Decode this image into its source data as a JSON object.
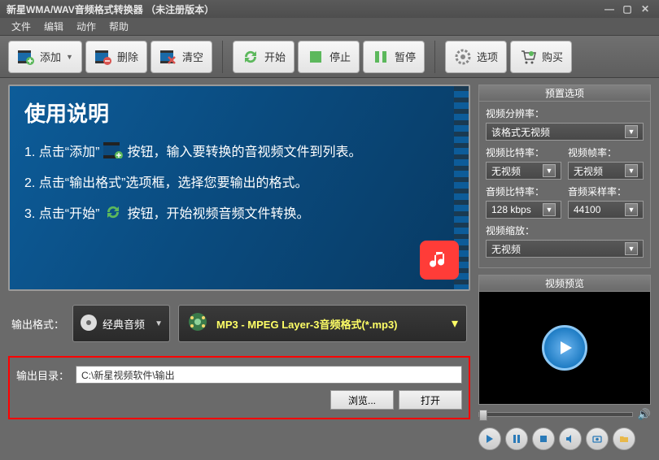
{
  "titlebar": {
    "title": "新星WMA/WAV音频格式转换器 （未注册版本）"
  },
  "menu": {
    "file": "文件",
    "edit": "编辑",
    "action": "动作",
    "help": "帮助"
  },
  "toolbar": {
    "add": "添加",
    "delete": "删除",
    "clear": "清空",
    "start": "开始",
    "stop": "停止",
    "pause": "暂停",
    "options": "选项",
    "buy": "购买"
  },
  "instruction": {
    "heading": "使用说明",
    "line1a": "1. 点击“添加”",
    "line1b": "按钮，输入要转换的音视频文件到列表。",
    "line2": "2. 点击“输出格式”选项框，选择您要输出的格式。",
    "line3a": "3. 点击“开始”",
    "line3b": "按钮，开始视频音频文件转换。"
  },
  "output_format": {
    "label": "输出格式：",
    "category": "经典音频",
    "format": "MP3 - MPEG Layer-3音频格式(*.mp3)"
  },
  "output_dir": {
    "label": "输出目录：",
    "path": "C:\\新星视频软件\\输出",
    "browse": "浏览...",
    "open": "打开"
  },
  "preset": {
    "title": "预置选项",
    "resolution_label": "视频分辨率：",
    "resolution": "该格式无视频",
    "vbitrate_label": "视频比特率：",
    "vbitrate": "无视频",
    "vframerate_label": "视频帧率：",
    "vframerate": "无视频",
    "abitrate_label": "音频比特率：",
    "abitrate": "128 kbps",
    "asamplerate_label": "音频采样率：",
    "asamplerate": "44100",
    "vzoom_label": "视频缩放：",
    "vzoom": "无视频"
  },
  "preview": {
    "title": "视频预览"
  }
}
